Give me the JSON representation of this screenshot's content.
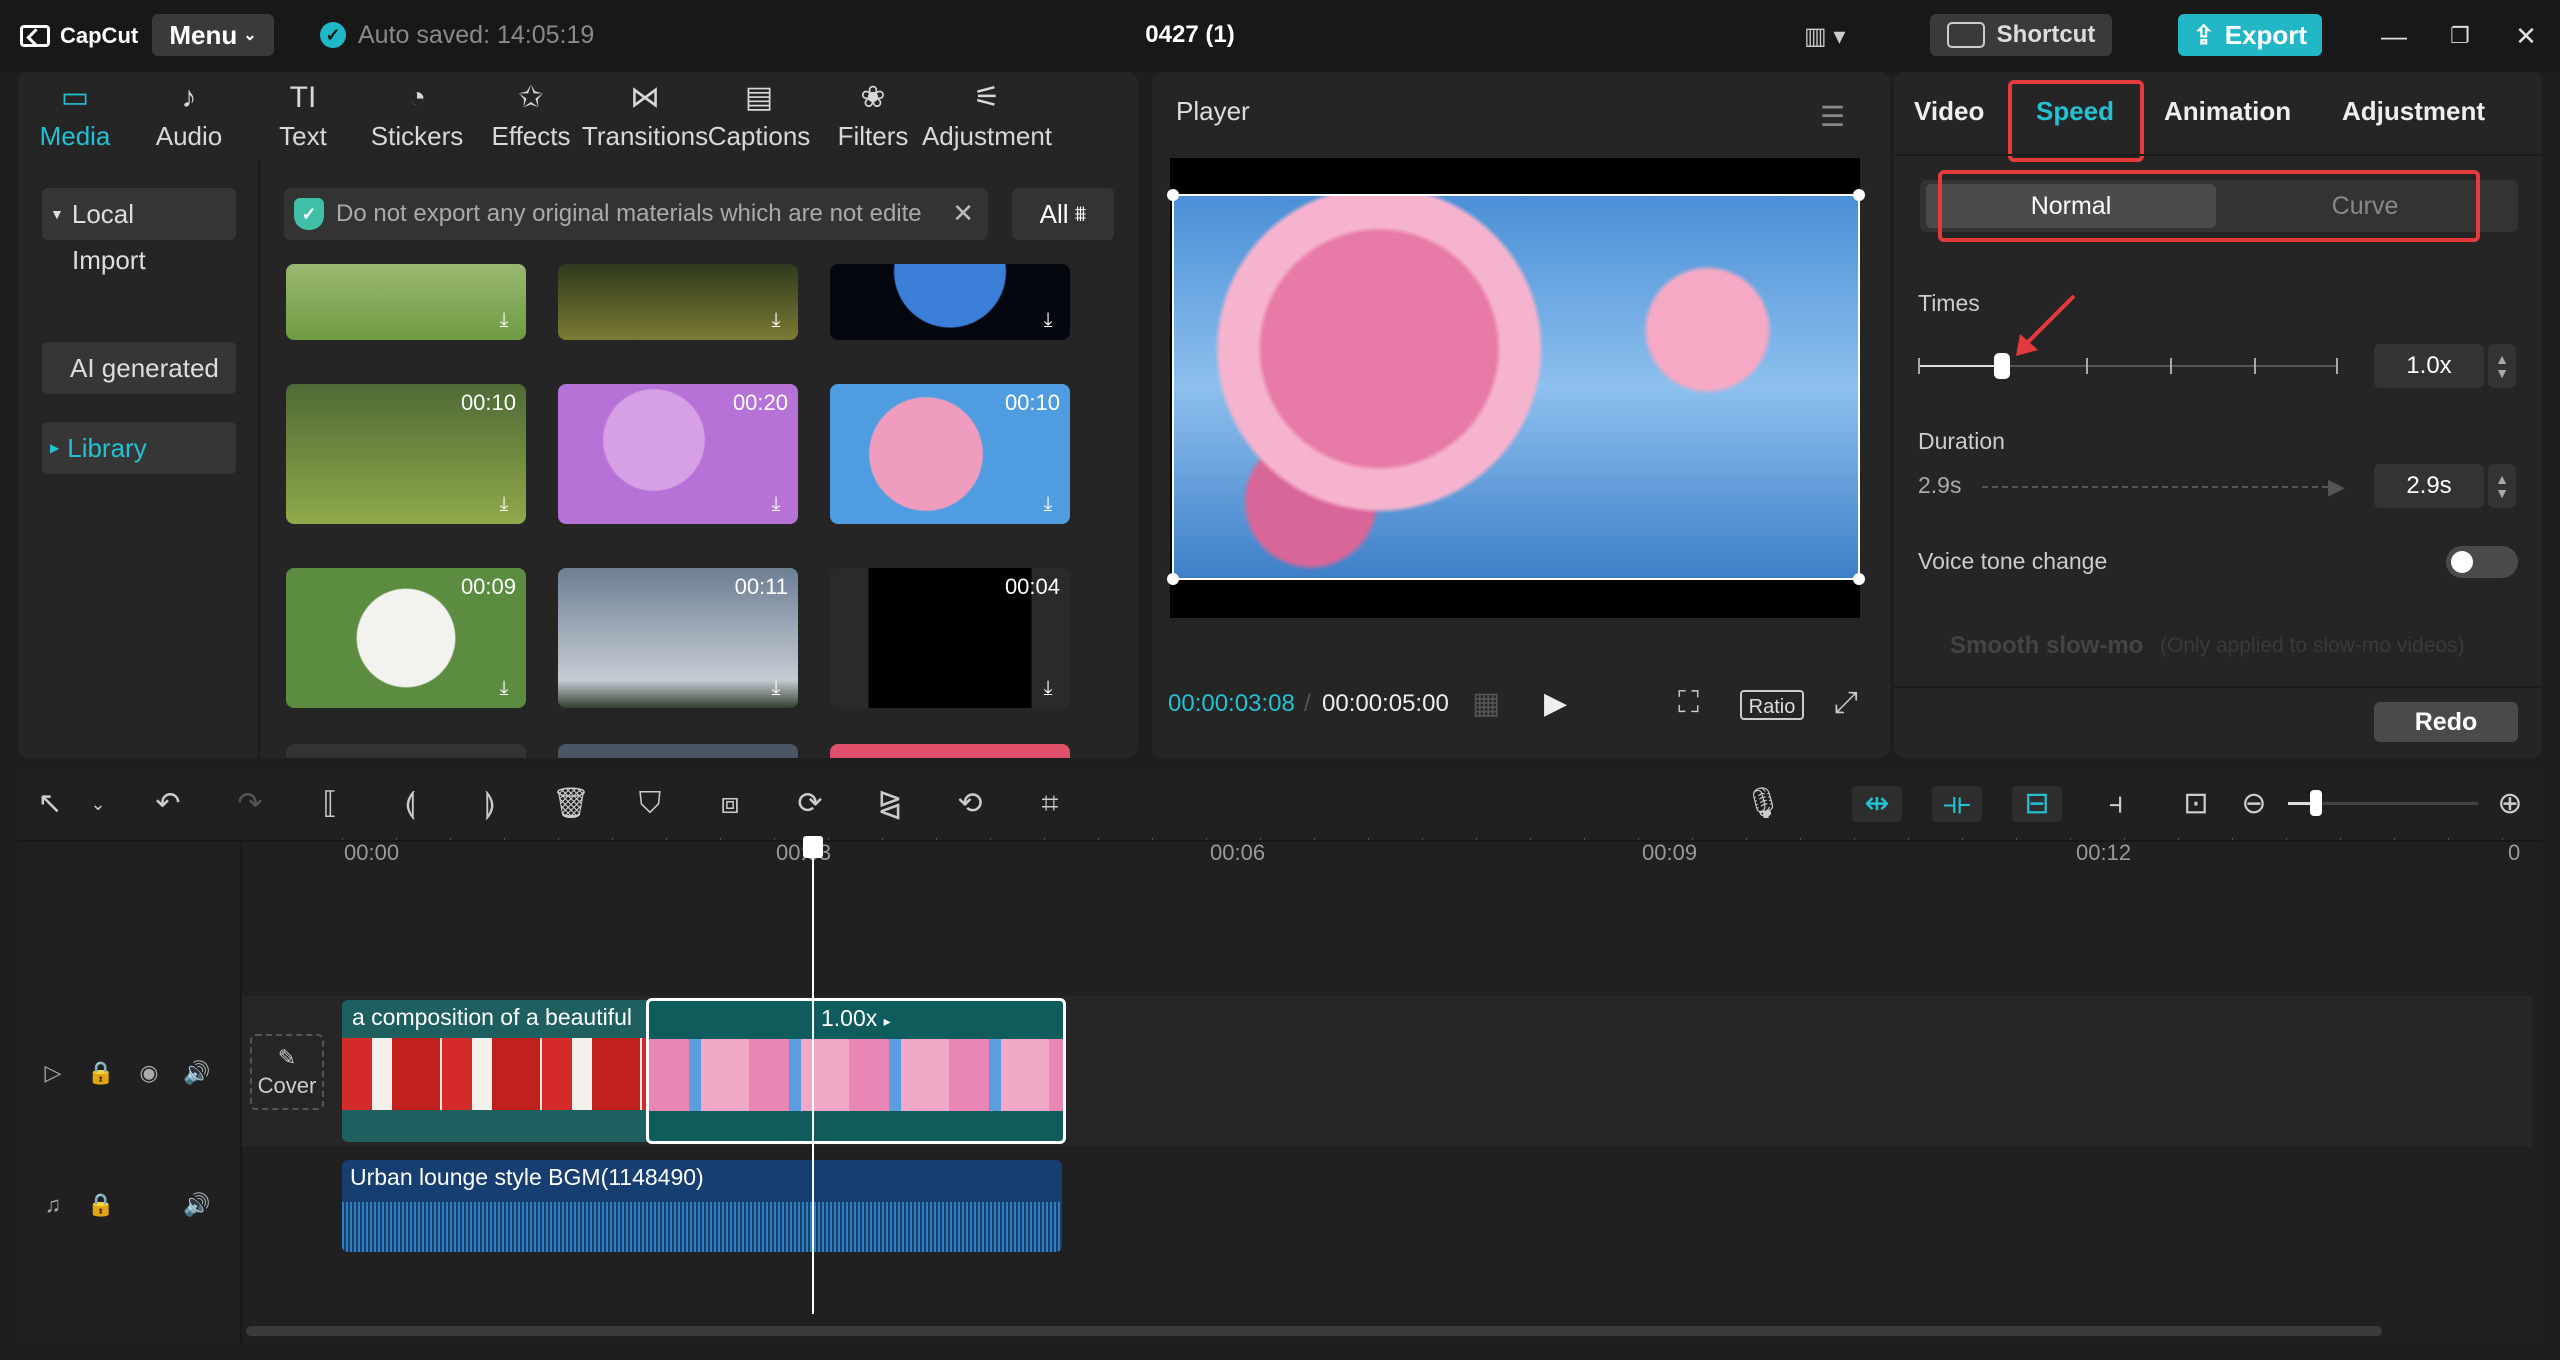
{
  "app": {
    "name": "CapCut",
    "menu_label": "Menu",
    "autosave_text": "Auto saved: 14:05:19",
    "project_title": "0427 (1)",
    "shortcut_label": "Shortcut",
    "export_label": "Export"
  },
  "media_tabs": [
    {
      "label": "Media",
      "icon": "media-icon",
      "glyph": "▭"
    },
    {
      "label": "Audio",
      "icon": "audio-icon",
      "glyph": "♪"
    },
    {
      "label": "Text",
      "icon": "text-icon",
      "glyph": "TI"
    },
    {
      "label": "Stickers",
      "icon": "sticker-icon",
      "glyph": "◔"
    },
    {
      "label": "Effects",
      "icon": "effects-icon",
      "glyph": "✩"
    },
    {
      "label": "Transitions",
      "icon": "transitions-icon",
      "glyph": "⋈"
    },
    {
      "label": "Captions",
      "icon": "captions-icon",
      "glyph": "▤"
    },
    {
      "label": "Filters",
      "icon": "filters-icon",
      "glyph": "❀"
    },
    {
      "label": "Adjustment",
      "icon": "adjustment-icon",
      "glyph": "⚟"
    }
  ],
  "sidebar": {
    "local": "Local",
    "import": "Import",
    "ai_generated": "AI generated",
    "library": "Library"
  },
  "notice": {
    "text": "Do not export any original materials which are not edite"
  },
  "filter_label": "All",
  "thumbnails": [
    {
      "duration": "00:10"
    },
    {
      "duration": "00:20"
    },
    {
      "duration": "00:10"
    },
    {
      "duration": "00:09"
    },
    {
      "duration": "00:11"
    },
    {
      "duration": "00:04"
    }
  ],
  "player": {
    "title": "Player",
    "current_time": "00:00:03:08",
    "total_time": "00:00:05:00",
    "ratio_label": "Ratio"
  },
  "right_panel": {
    "tabs": [
      "Video",
      "Speed",
      "Animation",
      "Adjustment"
    ],
    "active_tab": "Speed",
    "modes": {
      "normal": "Normal",
      "curve": "Curve"
    },
    "times_label": "Times",
    "times_value": "1.0x",
    "duration_label": "Duration",
    "duration_from": "2.9s",
    "duration_value": "2.9s",
    "voice_tone_label": "Voice tone change",
    "smooth_label": "Smooth slow-mo",
    "smooth_note": "(Only applied to slow-mo videos)",
    "redo_label": "Redo"
  },
  "timeline": {
    "ruler": [
      "00:00",
      "00:03",
      "00:06",
      "00:09",
      "00:12",
      "0"
    ],
    "clip_a_title": "a composition of a beautiful",
    "clip_b_speed": "1.00x",
    "cover_label": "Cover",
    "audio_title": "Urban lounge style BGM(1148490)"
  },
  "colors": {
    "accent": "#22c1d3",
    "highlight": "#e33b3b",
    "panel": "#252525"
  }
}
